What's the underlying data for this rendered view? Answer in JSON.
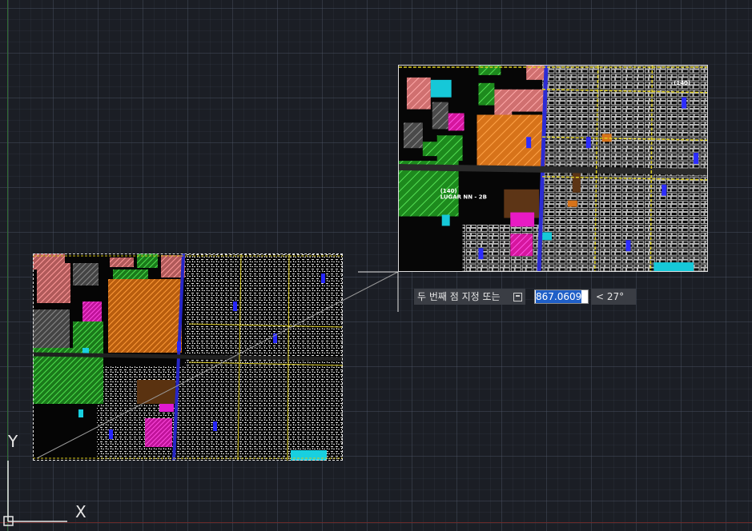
{
  "command_prompt": {
    "text": "두 번째 점 지정 또는",
    "icon": "keyboard-icon",
    "distance_value": "867.0609",
    "angle_text": "< 27°"
  },
  "ucs_icon": {
    "y_label": "Y",
    "x_label": "X"
  },
  "map_labels": {
    "block_label": "(140)",
    "street_label": "LUGAR NN - 2B",
    "corner_label": "(140)"
  },
  "colors": {
    "background": "#1b1e25",
    "input_selection": "#1f5fc7",
    "tooltip_bg": "#3a3d44"
  }
}
